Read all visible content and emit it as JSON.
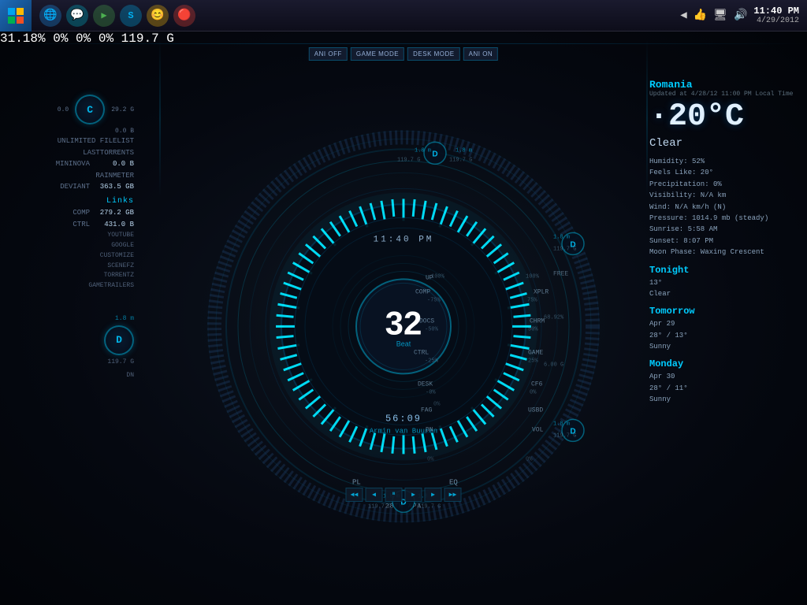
{
  "taskbar": {
    "time": "11:40 PM",
    "date": "4/29/2012",
    "start_label": "Windows",
    "icons": [
      {
        "name": "browser-icon",
        "symbol": "🌐",
        "color": "#2196F3"
      },
      {
        "name": "chat-icon",
        "symbol": "💬",
        "color": "#00BCD4"
      },
      {
        "name": "media-icon",
        "symbol": "▶",
        "color": "#4CAF50"
      },
      {
        "name": "skype-icon",
        "symbol": "S",
        "color": "#00AFF0"
      },
      {
        "name": "emoji-icon",
        "symbol": "😊",
        "color": "#FFC107"
      },
      {
        "name": "app-icon",
        "symbol": "🔴",
        "color": "#F44336"
      }
    ]
  },
  "hud": {
    "time_display": "11:40  PM",
    "center_number": "32",
    "center_label": "Beat",
    "track_time": "56:09",
    "track_name": "Armin van Buuren",
    "buttons": [
      {
        "id": "ani-off",
        "label": "ANI OFF"
      },
      {
        "id": "game-mode",
        "label": "GAME MODE"
      },
      {
        "id": "desk-mode",
        "label": "DESK MODE"
      },
      {
        "id": "ani-on",
        "label": "ANI ON"
      }
    ],
    "left_labels": [
      {
        "id": "up",
        "label": "UP"
      },
      {
        "id": "comp",
        "label": "COMP"
      },
      {
        "id": "docs",
        "label": "DOCS"
      },
      {
        "id": "ctrl",
        "label": "CTRL"
      },
      {
        "id": "desk",
        "label": "DESK"
      },
      {
        "id": "fag",
        "label": "FAG"
      },
      {
        "id": "dn",
        "label": "DN"
      }
    ],
    "right_labels": [
      {
        "id": "xplr",
        "label": "XPLR"
      },
      {
        "id": "chrm",
        "label": "CHRM"
      },
      {
        "id": "game",
        "label": "GAME"
      },
      {
        "id": "cf6",
        "label": "CF6"
      },
      {
        "id": "usbd",
        "label": "USBD"
      },
      {
        "id": "vol",
        "label": "VOL"
      }
    ],
    "bottom_labels": [
      {
        "id": "pl",
        "label": "PL"
      },
      {
        "id": "eq",
        "label": "EQ"
      }
    ],
    "bottom_track": "28TH  APA",
    "percentages_left": [
      "100%",
      "-75%",
      "-50%",
      "-25%",
      "-0%",
      "0%"
    ],
    "percentages_right": [
      "100%",
      "75%",
      "50%",
      "25%",
      "0%"
    ],
    "indicators": [
      {
        "id": "top",
        "value": "1.8 m",
        "ring_val": "119.7 G"
      },
      {
        "id": "bottom",
        "value": "1.8 m",
        "ring_val": "119.7 G"
      },
      {
        "id": "left-top",
        "value": "1.8 m",
        "ring_val": "119.7 G"
      },
      {
        "id": "left-bottom",
        "value": "1.8 m",
        "ring_val": "119.7 G"
      },
      {
        "id": "right-top",
        "value": "1.8 m",
        "ring_val": "119.7 G"
      },
      {
        "id": "right-bottom",
        "value": "1.8 m",
        "ring_val": "119.7 G"
      }
    ],
    "free_label": "FREE",
    "dot_value": "0.0"
  },
  "left_panel": {
    "items": [
      {
        "label": "UNLIMITED FILELIST",
        "value": ""
      },
      {
        "label": "LASTTORRENTS",
        "value": ""
      },
      {
        "label": "MININOVA",
        "value": "0.0 B"
      },
      {
        "label": "RAINMETER",
        "value": ""
      },
      {
        "label": "DEVIANT",
        "value": "363.5 GB"
      }
    ],
    "stats": [
      {
        "label": "",
        "value": "0.0"
      },
      {
        "label": "",
        "value": "29.2 G"
      },
      {
        "label": "",
        "value": "0.0 B"
      }
    ],
    "links_title": "Links",
    "links": [
      "YOUTUBE",
      "GOOGLE",
      "CUSTOMIZE",
      "SCENEFZ",
      "TORRENTZ",
      "GAMETRAILERS"
    ],
    "comp_value": "279.2 GB",
    "ctrl_value": "431.0 B"
  },
  "weather": {
    "location": "Romania",
    "updated": "Updated at 4/28/12 11:00 PM Local Time",
    "temperature": "·20°C",
    "condition": "Clear",
    "details": [
      "Humidity: 52%",
      "Feels Like: 20°",
      "Precipitation: 0%",
      "Visibility: N/A km",
      "Wind: N/A km/h (N)",
      "Pressure: 1014.9 mb (steady)",
      "Sunrise: 5:58 AM",
      "Sunset: 8:07 PM",
      "Moon Phase: Waxing Crescent"
    ],
    "forecast": [
      {
        "period": "Tonight",
        "temp": "13°",
        "condition": "Clear"
      },
      {
        "period": "Tomorrow",
        "date": "Apr 29",
        "temp": "28° / 13°",
        "condition": "Sunny"
      },
      {
        "period": "Monday",
        "date": "Apr 30",
        "temp": "28° / 11°",
        "condition": "Sunny"
      }
    ]
  },
  "hud_perc": {
    "left_top": "100%",
    "left_2": "-75%",
    "left_3": "-50%",
    "left_4": "-25%",
    "left_5": "-0%",
    "right_top": "100%",
    "right_2": "75%",
    "right_3": "50%",
    "right_4": "25%",
    "right_5": "0%",
    "bottom_left_0": "0%",
    "bottom_left_50": "50%",
    "bottom_right_0": "0%",
    "bottom_right_50": "50%"
  }
}
